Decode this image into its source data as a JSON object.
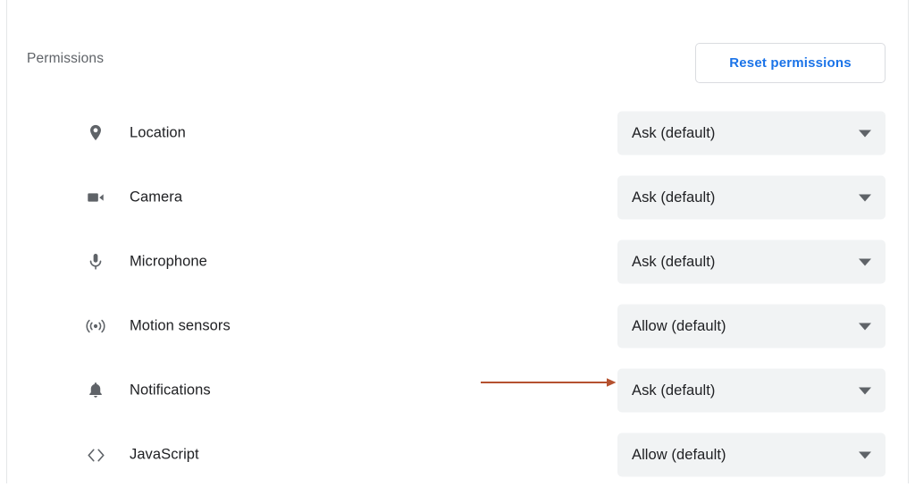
{
  "section": {
    "title": "Permissions",
    "reset_button_label": "Reset permissions",
    "accent_link_color": "#1a73e8",
    "title_color": "#5f6368",
    "select_background_color": "#f1f3f4"
  },
  "permissions": [
    {
      "icon": "location-pin-icon",
      "label": "Location",
      "value": "Ask (default)"
    },
    {
      "icon": "video-camera-icon",
      "label": "Camera",
      "value": "Ask (default)"
    },
    {
      "icon": "microphone-icon",
      "label": "Microphone",
      "value": "Ask (default)"
    },
    {
      "icon": "motion-sensors-icon",
      "label": "Motion sensors",
      "value": "Allow (default)"
    },
    {
      "icon": "bell-icon",
      "label": "Notifications",
      "value": "Ask (default)"
    },
    {
      "icon": "code-brackets-icon",
      "label": "JavaScript",
      "value": "Allow (default)"
    }
  ],
  "annotation": {
    "type": "arrow",
    "points_to": "Notifications permission dropdown",
    "color": "#b5512f"
  }
}
